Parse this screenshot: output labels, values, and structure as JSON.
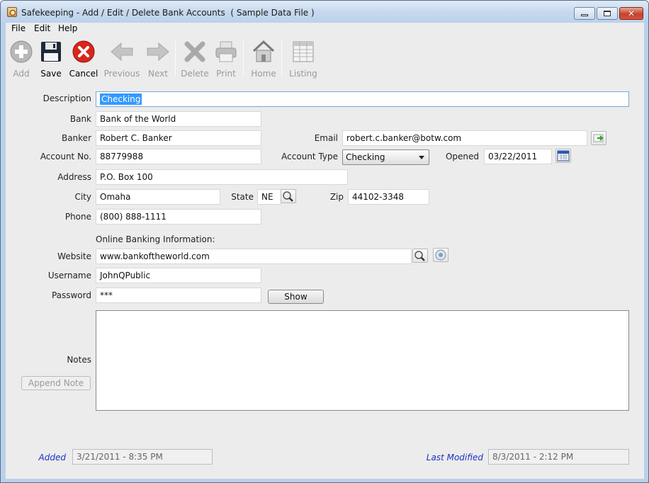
{
  "window": {
    "title": "Safekeeping - Add / Edit / Delete Bank Accounts  ( Sample Data File )"
  },
  "menu": {
    "file": "File",
    "edit": "Edit",
    "help": "Help"
  },
  "toolbar": {
    "add": "Add",
    "save": "Save",
    "cancel": "Cancel",
    "previous": "Previous",
    "next": "Next",
    "delete": "Delete",
    "print": "Print",
    "home": "Home",
    "listing": "Listing"
  },
  "form": {
    "labels": {
      "description": "Description",
      "bank": "Bank",
      "banker": "Banker",
      "email": "Email",
      "account_no": "Account No.",
      "account_type": "Account Type",
      "opened": "Opened",
      "address": "Address",
      "city": "City",
      "state": "State",
      "zip": "Zip",
      "phone": "Phone",
      "online_banking": "Online Banking Information:",
      "website": "Website",
      "username": "Username",
      "password": "Password",
      "notes": "Notes",
      "added": "Added",
      "last_modified": "Last Modified"
    },
    "values": {
      "description": "Checking",
      "bank": "Bank of the World",
      "banker": "Robert C. Banker",
      "email": "robert.c.banker@botw.com",
      "account_no": "88779988",
      "account_type": "Checking",
      "opened": "03/22/2011",
      "address": "P.O. Box 100",
      "city": "Omaha",
      "state": "NE",
      "zip": "44102-3348",
      "phone": "(800) 888-1111",
      "website": "www.bankoftheworld.com",
      "username": "JohnQPublic",
      "password": "***",
      "notes": "",
      "added": "3/21/2011 - 8:35 PM",
      "last_modified": "8/3/2011 - 2:12 PM"
    },
    "buttons": {
      "show": "Show",
      "append_note": "Append Note"
    }
  },
  "colors": {
    "selection": "#3399ff",
    "accent_label": "#1c2fc4",
    "titlebar": "#c6d8ee",
    "close_button": "#c8412a"
  }
}
